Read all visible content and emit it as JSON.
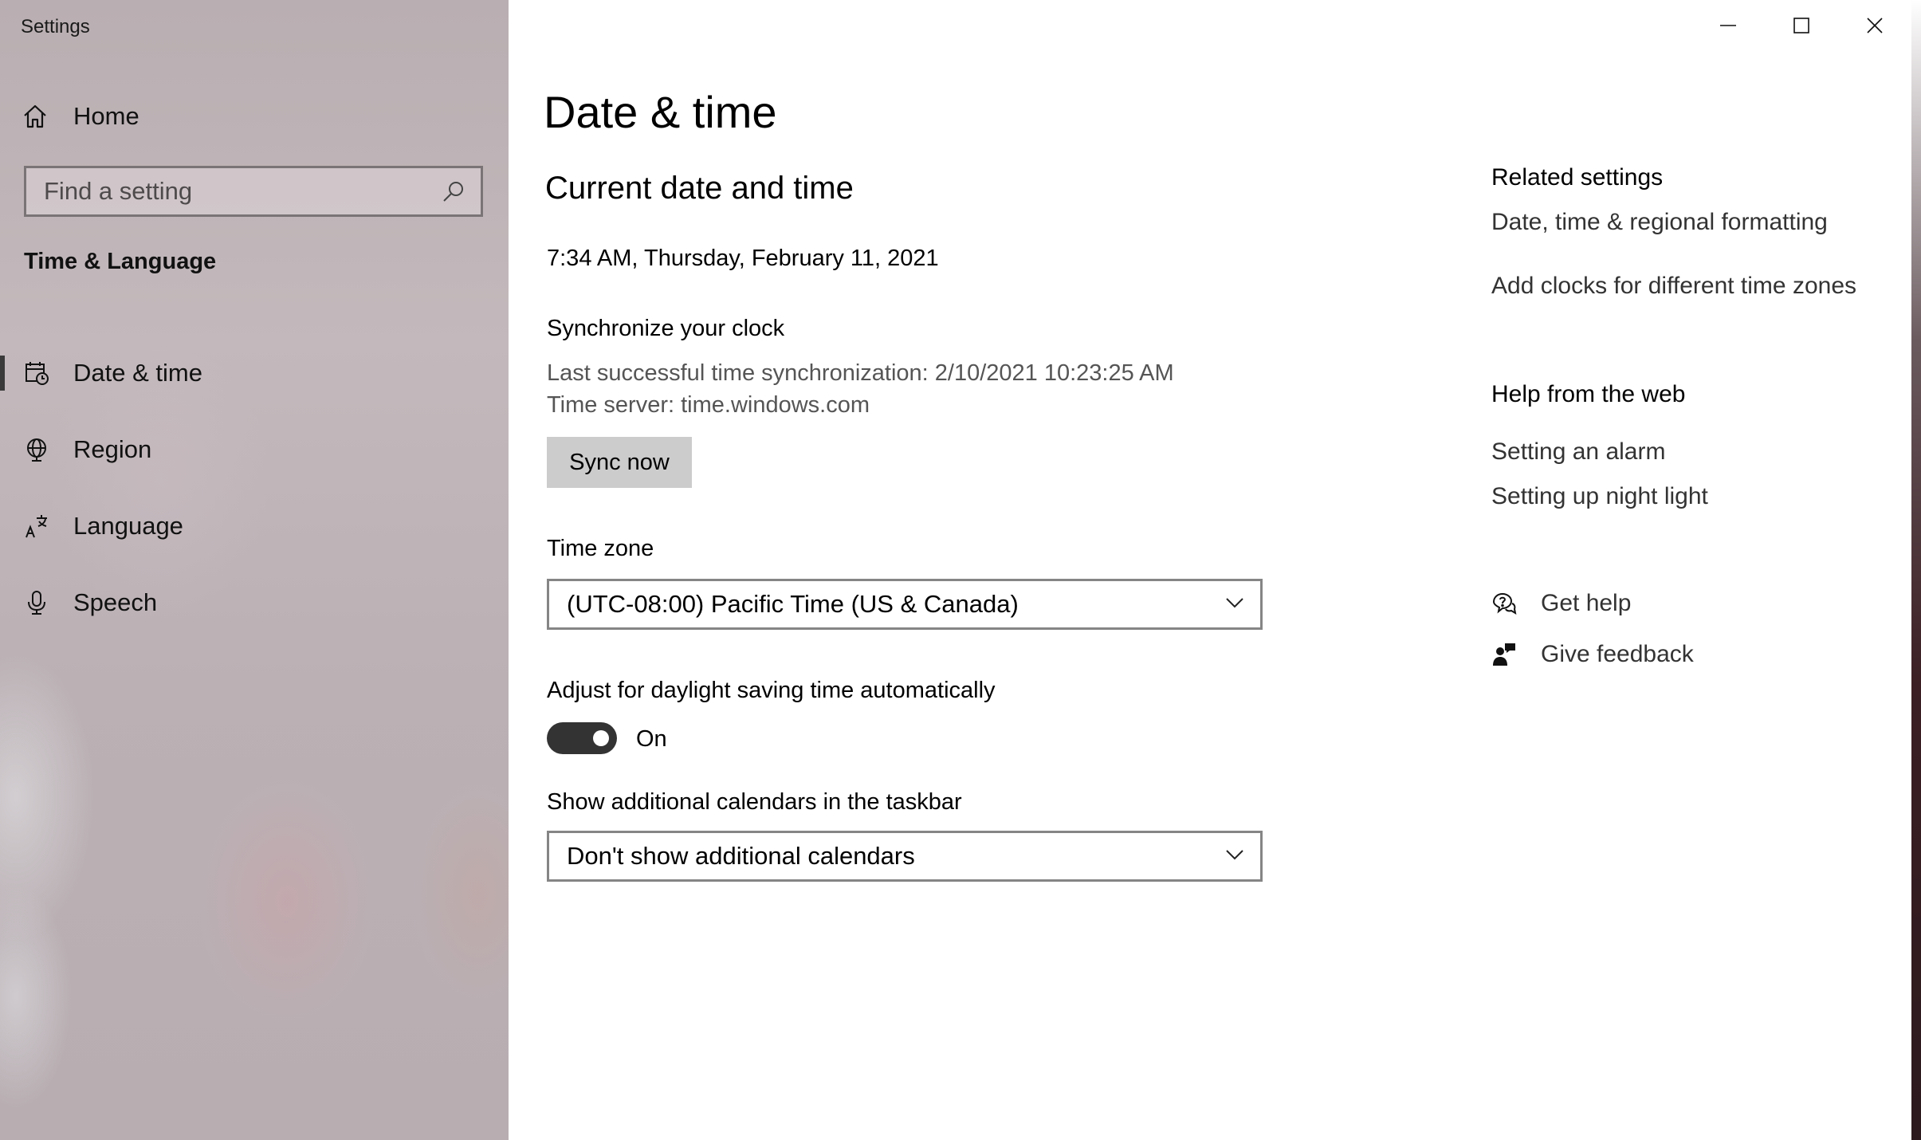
{
  "window": {
    "title": "Settings"
  },
  "sidebar": {
    "home_label": "Home",
    "search_placeholder": "Find a setting",
    "section_title": "Time & Language",
    "items": [
      {
        "label": "Date & time",
        "icon": "calendar-clock-icon",
        "selected": true
      },
      {
        "label": "Region",
        "icon": "globe-icon",
        "selected": false
      },
      {
        "label": "Language",
        "icon": "language-icon",
        "selected": false
      },
      {
        "label": "Speech",
        "icon": "microphone-icon",
        "selected": false
      }
    ]
  },
  "main": {
    "page_title": "Date & time",
    "current_heading": "Current date and time",
    "current_datetime": "7:34 AM, Thursday, February 11, 2021",
    "sync": {
      "label": "Synchronize your clock",
      "last_sync": "Last successful time synchronization: 2/10/2021 10:23:25 AM",
      "server": "Time server: time.windows.com",
      "button": "Sync now"
    },
    "timezone": {
      "label": "Time zone",
      "value": "(UTC-08:00) Pacific Time (US & Canada)"
    },
    "dst": {
      "label": "Adjust for daylight saving time automatically",
      "state": "On",
      "on": true
    },
    "calendars": {
      "label": "Show additional calendars in the taskbar",
      "value": "Don't show additional calendars"
    }
  },
  "related": {
    "heading": "Related settings",
    "links": [
      "Date, time & regional formatting",
      "Add clocks for different time zones"
    ]
  },
  "help": {
    "heading": "Help from the web",
    "links": [
      "Setting an alarm",
      "Setting up night light"
    ]
  },
  "actions": {
    "get_help": "Get help",
    "give_feedback": "Give feedback"
  },
  "colors": {
    "toggle_on": "#333333",
    "sync_button_bg": "#cccccc",
    "selected_indicator": "#3a3a3a"
  }
}
